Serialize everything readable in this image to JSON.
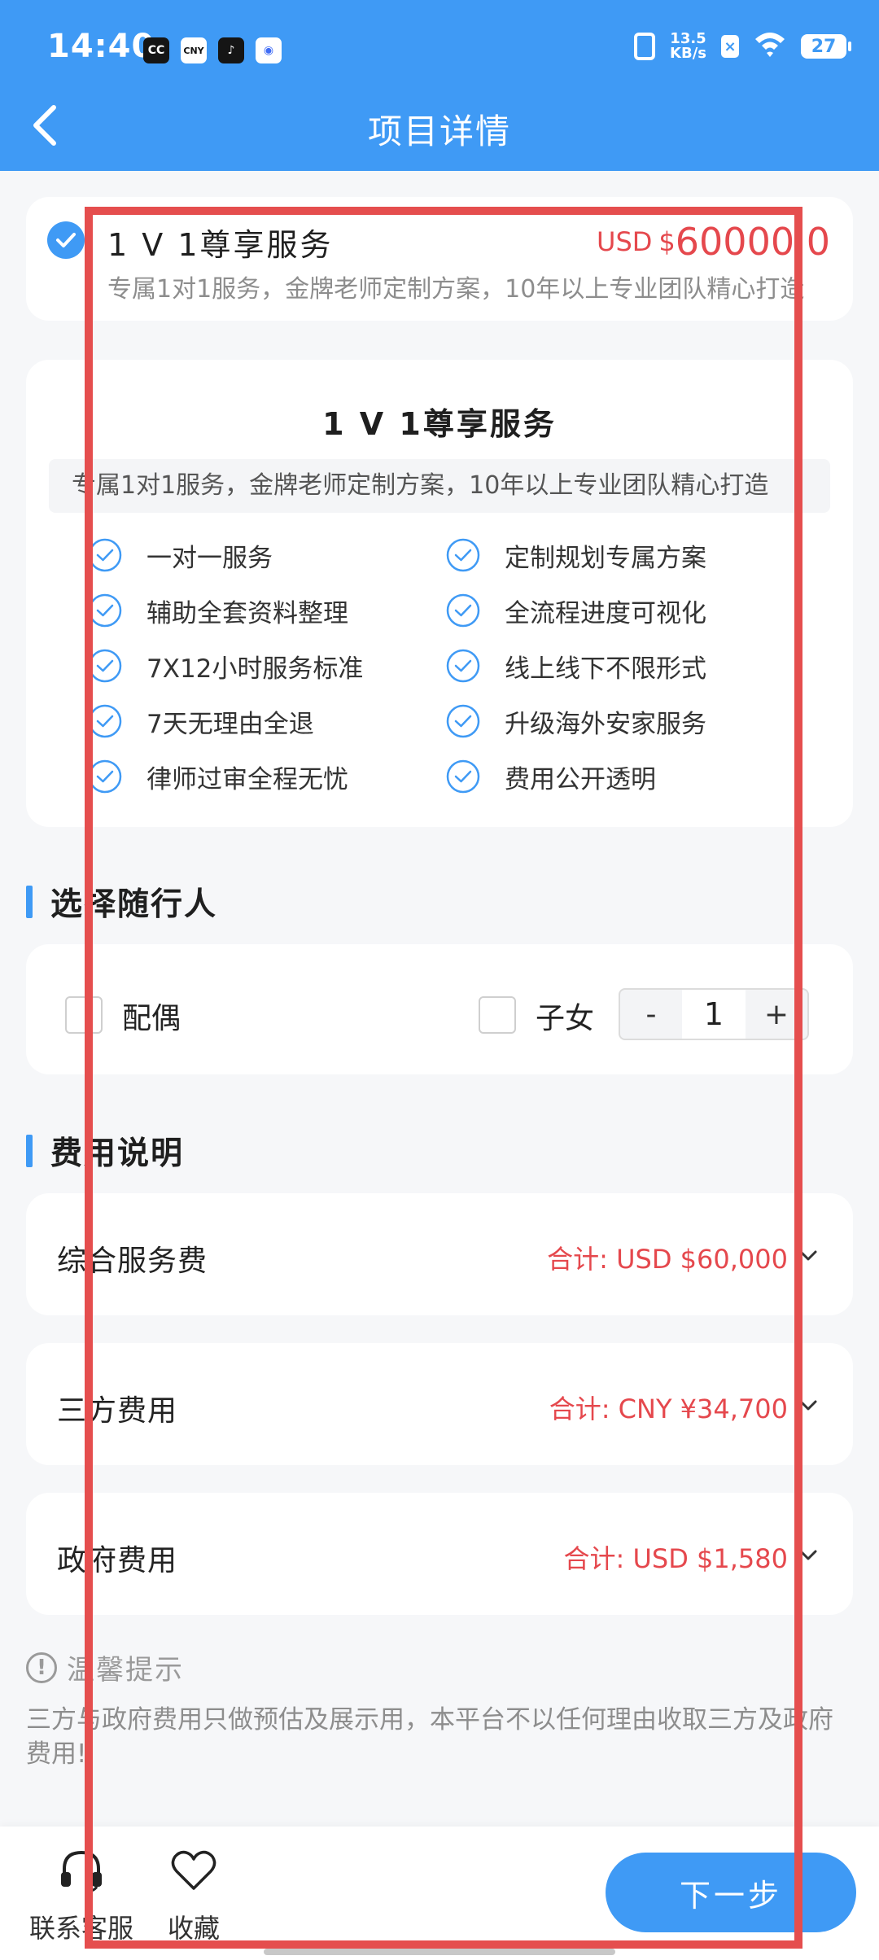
{
  "status_bar": {
    "time": "14:40",
    "apps": [
      "CC",
      "CNY",
      "♪",
      "◉"
    ],
    "net_speed_value": "13.5",
    "net_speed_unit": "KB/s",
    "battery": "27"
  },
  "header": {
    "title": "项目详情"
  },
  "service": {
    "name": "1 V 1尊享服务",
    "currency": "USD",
    "price_symbol": "$",
    "price": "60000.0",
    "desc": "专属1对1服务，金牌老师定制方案，10年以上专业团队精心打造"
  },
  "detail": {
    "title": "1 V 1尊享服务",
    "desc": "专属1对1服务，金牌老师定制方案，10年以上专业团队精心打造",
    "features": [
      "一对一服务",
      "定制规划专属方案",
      "辅助全套资料整理",
      "全流程进度可视化",
      "7X12小时服务标准",
      "线上线下不限形式",
      "7天无理由全退",
      "升级海外安家服务",
      "律师过审全程无忧",
      "费用公开透明"
    ]
  },
  "companions": {
    "section_title": "选择随行人",
    "spouse_label": "配偶",
    "children_label": "子女",
    "minus": "-",
    "count": "1",
    "plus": "+"
  },
  "fees": {
    "section_title": "费用说明",
    "items": [
      {
        "name": "综合服务费",
        "total": "合计: USD  $60,000"
      },
      {
        "name": "三方费用",
        "total": "合计: CNY  ¥34,700"
      },
      {
        "name": "政府费用",
        "total": "合计: USD  $1,580"
      }
    ]
  },
  "tip": {
    "icon": "!",
    "title": "温馨提示",
    "text": "三方与政府费用只做预估及展示用，本平台不以任何理由收取三方及政府费用!"
  },
  "bottom_bar": {
    "contact_label": "联系客服",
    "favorite_label": "收藏",
    "next_label": "下一步"
  },
  "colors": {
    "primary": "#3f9af5",
    "price_red": "#e5484d",
    "highlight": "#e54e4e"
  }
}
